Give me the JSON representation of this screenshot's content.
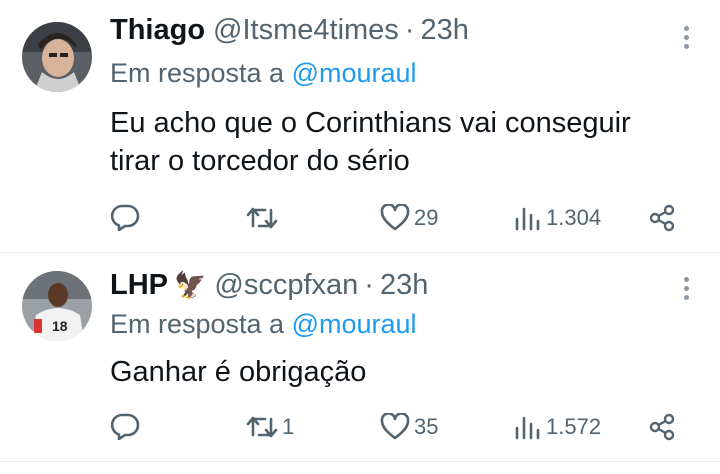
{
  "colors": {
    "text": "#0f1419",
    "secondary": "#536471",
    "link": "#1d9bf0",
    "divider": "#e6e9ec"
  },
  "tweets": [
    {
      "name": "Thiago",
      "handle": "@Itsme4times",
      "separator": "·",
      "time": "23h",
      "reply_prefix": "Em resposta a",
      "reply_to": "@mouraul",
      "text_lines": [
        "Eu acho que o Corinthians vai conseguir",
        "tirar o torcedor do sério"
      ],
      "reply_count": "",
      "retweet_count": "",
      "like_count": "29",
      "view_count": "1.304",
      "icons": [
        "reply-icon",
        "retweet-icon",
        "like-icon",
        "views-icon",
        "share-icon",
        "more-icon"
      ]
    },
    {
      "name": "LHP",
      "name_emoji": "🦅",
      "handle": "@sccpfxan",
      "separator": "·",
      "time": "23h",
      "reply_prefix": "Em resposta a",
      "reply_to": "@mouraul",
      "text_lines": [
        "Ganhar é obrigação"
      ],
      "reply_count": "",
      "retweet_count": "1",
      "like_count": "35",
      "view_count": "1.572",
      "icons": [
        "reply-icon",
        "retweet-icon",
        "like-icon",
        "views-icon",
        "share-icon",
        "more-icon"
      ]
    }
  ]
}
